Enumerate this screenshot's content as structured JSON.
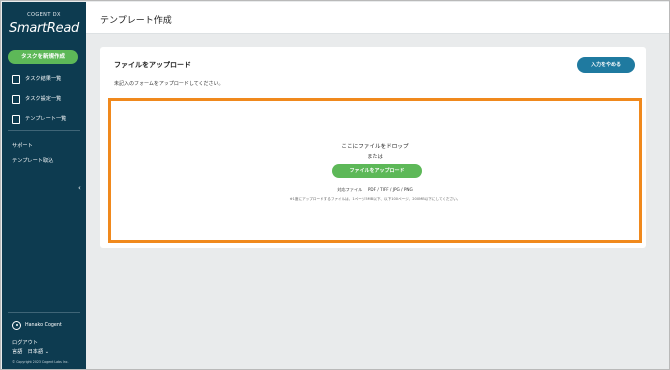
{
  "sidebar": {
    "brand_top": "COGENT DX",
    "brand_main": "SmartRead",
    "new_task_label": "タスクを新規作成",
    "items": [
      {
        "label": "タスク結果一覧",
        "icon": "document-icon"
      },
      {
        "label": "タスク設定一覧",
        "icon": "settings-document-icon"
      },
      {
        "label": "テンプレート一覧",
        "icon": "template-icon"
      }
    ],
    "support_label": "サポート",
    "template_import_label": "テンプレート取込",
    "collapse_glyph": "‹",
    "user_name": "Hanako Cogent",
    "logout_label": "ログアウト",
    "language_label": "言語　日本語 ⌄",
    "copyright": "© Copyright 2023 Cogent Labs Inc."
  },
  "header": {
    "title": "テンプレート作成"
  },
  "card": {
    "title": "ファイルをアップロード",
    "description": "未記入のフォームをアップロードしてください。",
    "stop_button_label": "入力をやめる"
  },
  "dropzone": {
    "title": "ここにファイルをドロップ",
    "or": "または",
    "upload_button_label": "ファイルをアップロード",
    "formats": "対応ファイル　 PDF / TIFF / JPG / PNG",
    "note": "※1度にアップロードするファイルは、1ページ5MB以下、以下100ページ、200MB以下にしてください。"
  },
  "colors": {
    "sidebar_bg": "#0d3b50",
    "primary_green": "#5db858",
    "primary_blue": "#1f7aa0",
    "highlight_orange": "#f0891d"
  }
}
